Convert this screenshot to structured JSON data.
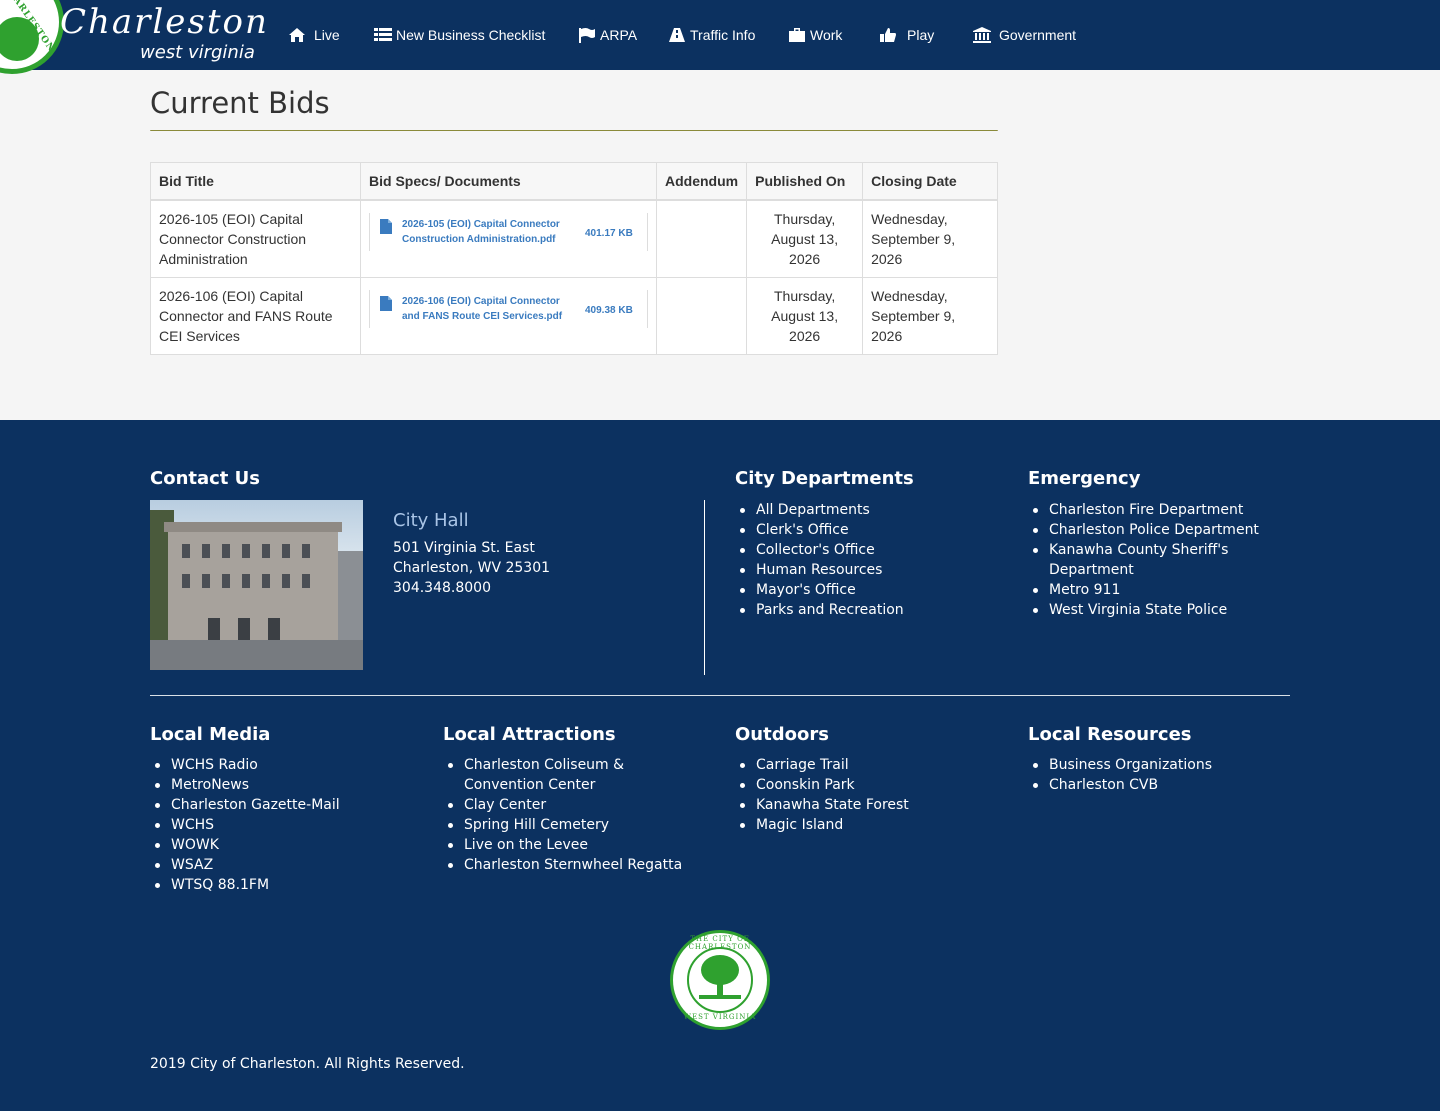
{
  "header": {
    "logo_script": "Charleston",
    "logo_sub": "west virginia",
    "seal_ring_text": "CHARLESTON",
    "nav": [
      {
        "label": "Live",
        "icon": "home-icon"
      },
      {
        "label": "New Business Checklist",
        "icon": "list-icon"
      },
      {
        "label": "ARPA",
        "icon": "flag-icon"
      },
      {
        "label": "Traffic Info",
        "icon": "road-icon"
      },
      {
        "label": "Work",
        "icon": "briefcase-icon"
      },
      {
        "label": "Play",
        "icon": "thumbs-up-icon"
      },
      {
        "label": "Government",
        "icon": "institution-icon"
      }
    ]
  },
  "main": {
    "title": "Current Bids",
    "table": {
      "headers": [
        "Bid Title",
        "Bid Specs/ Documents",
        "Addendum",
        "Published On",
        "Closing Date"
      ],
      "rows": [
        {
          "title": "2026-105 (EOI) Capital Connector Construction Administration",
          "doc_name": "2026-105 (EOI) Capital Connector Construction Administration.pdf",
          "doc_size": "401.17 KB",
          "addendum": "",
          "published": "Thursday, August 13, 2026",
          "closing": "Wednesday, September 9, 2026"
        },
        {
          "title": "2026-106 (EOI) Capital Connector and FANS Route CEI Services",
          "doc_name": "2026-106 (EOI) Capital Connector and FANS Route CEI Services.pdf",
          "doc_size": "409.38 KB",
          "addendum": "",
          "published": "Thursday, August 13, 2026",
          "closing": "Wednesday, September 9, 2026"
        }
      ]
    }
  },
  "footer": {
    "contact_heading": "Contact Us",
    "city_hall": {
      "title": "City Hall",
      "address1": "501 Virginia St. East",
      "address2": "Charleston, WV 25301",
      "phone": "304.348.8000"
    },
    "departments": {
      "heading": "City Departments",
      "items": [
        "All Departments",
        "Clerk's Office",
        "Collector's Office",
        "Human Resources",
        "Mayor's Office",
        "Parks and Recreation"
      ]
    },
    "emergency": {
      "heading": "Emergency",
      "items": [
        "Charleston Fire Department",
        "Charleston Police Department",
        "Kanawha County Sheriff's Department",
        "Metro 911",
        "West Virginia State Police"
      ]
    },
    "local_media": {
      "heading": "Local Media",
      "items": [
        "WCHS Radio",
        "MetroNews",
        "Charleston Gazette-Mail",
        "WCHS",
        "WOWK",
        "WSAZ",
        "WTSQ 88.1FM"
      ]
    },
    "local_attractions": {
      "heading": "Local Attractions",
      "items": [
        "Charleston Coliseum & Convention Center",
        "Clay Center",
        "Spring Hill Cemetery",
        "Live on the Levee",
        "Charleston Sternwheel Regatta"
      ]
    },
    "outdoors": {
      "heading": "Outdoors",
      "items": [
        "Carriage Trail",
        "Coonskin Park",
        "Kanawha State Forest",
        "Magic Island"
      ]
    },
    "local_resources": {
      "heading": "Local Resources",
      "items": [
        "Business Organizations",
        "Charleston CVB"
      ]
    },
    "seal_top": "THE CITY OF CHARLESTON",
    "seal_bottom": "WEST VIRGINIA",
    "copyright": "2019 City of Charleston. All Rights Reserved."
  },
  "colors": {
    "navy": "#0c3160",
    "accent_green": "#2fa12f",
    "link_blue": "#3a7bbf",
    "city_hall_blue": "#a9c4e6"
  }
}
